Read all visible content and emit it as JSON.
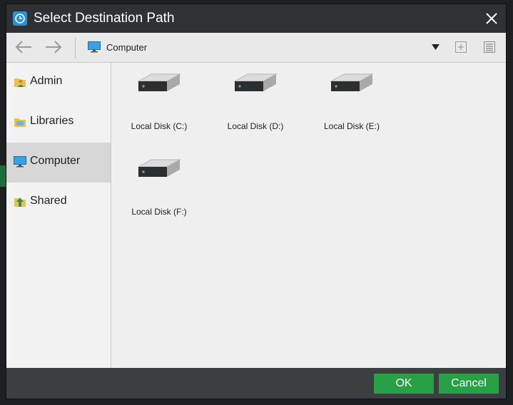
{
  "dialog": {
    "title": "Select Destination Path",
    "icon": "backup-clock-icon"
  },
  "toolbar": {
    "back_icon": "arrow-left-icon",
    "forward_icon": "arrow-right-icon",
    "path": "Computer",
    "path_icon": "monitor-icon",
    "dropdown_icon": "triangle-down-icon",
    "new_folder_icon": "plus-square-icon",
    "view_icon": "list-view-icon"
  },
  "sidebar": {
    "items": [
      {
        "label": "Admin",
        "icon": "user-folder-icon"
      },
      {
        "label": "Libraries",
        "icon": "libraries-folder-icon"
      },
      {
        "label": "Computer",
        "icon": "monitor-icon",
        "active": true
      },
      {
        "label": "Shared",
        "icon": "shared-folder-icon"
      }
    ]
  },
  "drives": [
    {
      "label": "Local Disk (C:)"
    },
    {
      "label": "Local Disk (D:)"
    },
    {
      "label": "Local Disk (E:)"
    },
    {
      "label": "Local Disk (F:)"
    }
  ],
  "footer": {
    "ok_label": "OK",
    "cancel_label": "Cancel"
  },
  "colors": {
    "button_green": "#27a046",
    "dialog_frame": "#3c3e41",
    "title_icon_blue": "#2b8fd6"
  }
}
